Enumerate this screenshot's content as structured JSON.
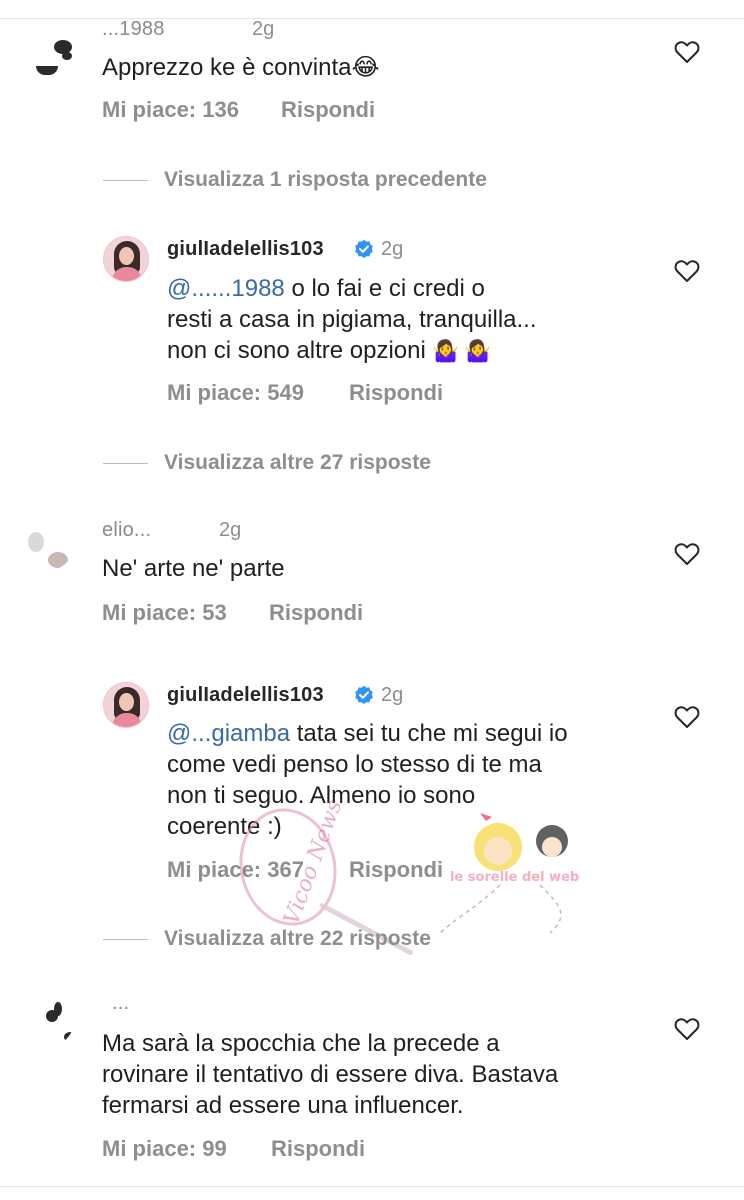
{
  "colors": {
    "text": "#1f1f1f",
    "meta": "#8e8e8e",
    "mention": "#3869a8",
    "verified": "#2f95f5",
    "divider": "#e6e6e6"
  },
  "comment1": {
    "username": "...1988",
    "time": "2g",
    "text": "Apprezzo ke è convinta",
    "emoji": "😂",
    "likes": "Mi piace: 136",
    "reply": "Rispondi"
  },
  "view_previous": "Visualizza 1 risposta precedente",
  "reply1": {
    "username": "giulIadelellis103",
    "time": "2g",
    "mention": "@......1988",
    "line1": "o lo fai e ci credi o",
    "line2": "resti a casa in pigiama, tranquilla...",
    "line3": "non ci sono altre opzioni",
    "emoji": "🤷‍♀️ 🤷‍♀️",
    "likes": "Mi piace: 549",
    "reply": "Rispondi"
  },
  "view_more_1": "Visualizza altre 27 risposte",
  "comment2": {
    "username": "elio...",
    "time": "2g",
    "text": "Ne' arte ne' parte",
    "likes": "Mi piace: 53",
    "reply": "Rispondi"
  },
  "reply2": {
    "username": "giulIadelellis103",
    "time": "2g",
    "mention": "@...giamba",
    "line1": "tata sei tu che mi segui io",
    "line2": "come vedi penso lo stesso di te ma",
    "line3": "non ti seguo. Almeno io sono",
    "line4": "coerente :)",
    "likes": "Mi piace: 367",
    "reply": "Rispondi"
  },
  "view_more_2": "Visualizza altre 22 risposte",
  "comment3": {
    "username": "...",
    "line1": "Ma sarà la spocchia che la precede a",
    "line2": "rovinare il tentativo di essere diva. Bastava",
    "line3": "fermarsi ad essere una influencer.",
    "likes": "Mi piace: 99",
    "reply": "Rispondi"
  },
  "watermark": {
    "text": "Vicoo News",
    "text2": "le sorelle del web"
  }
}
